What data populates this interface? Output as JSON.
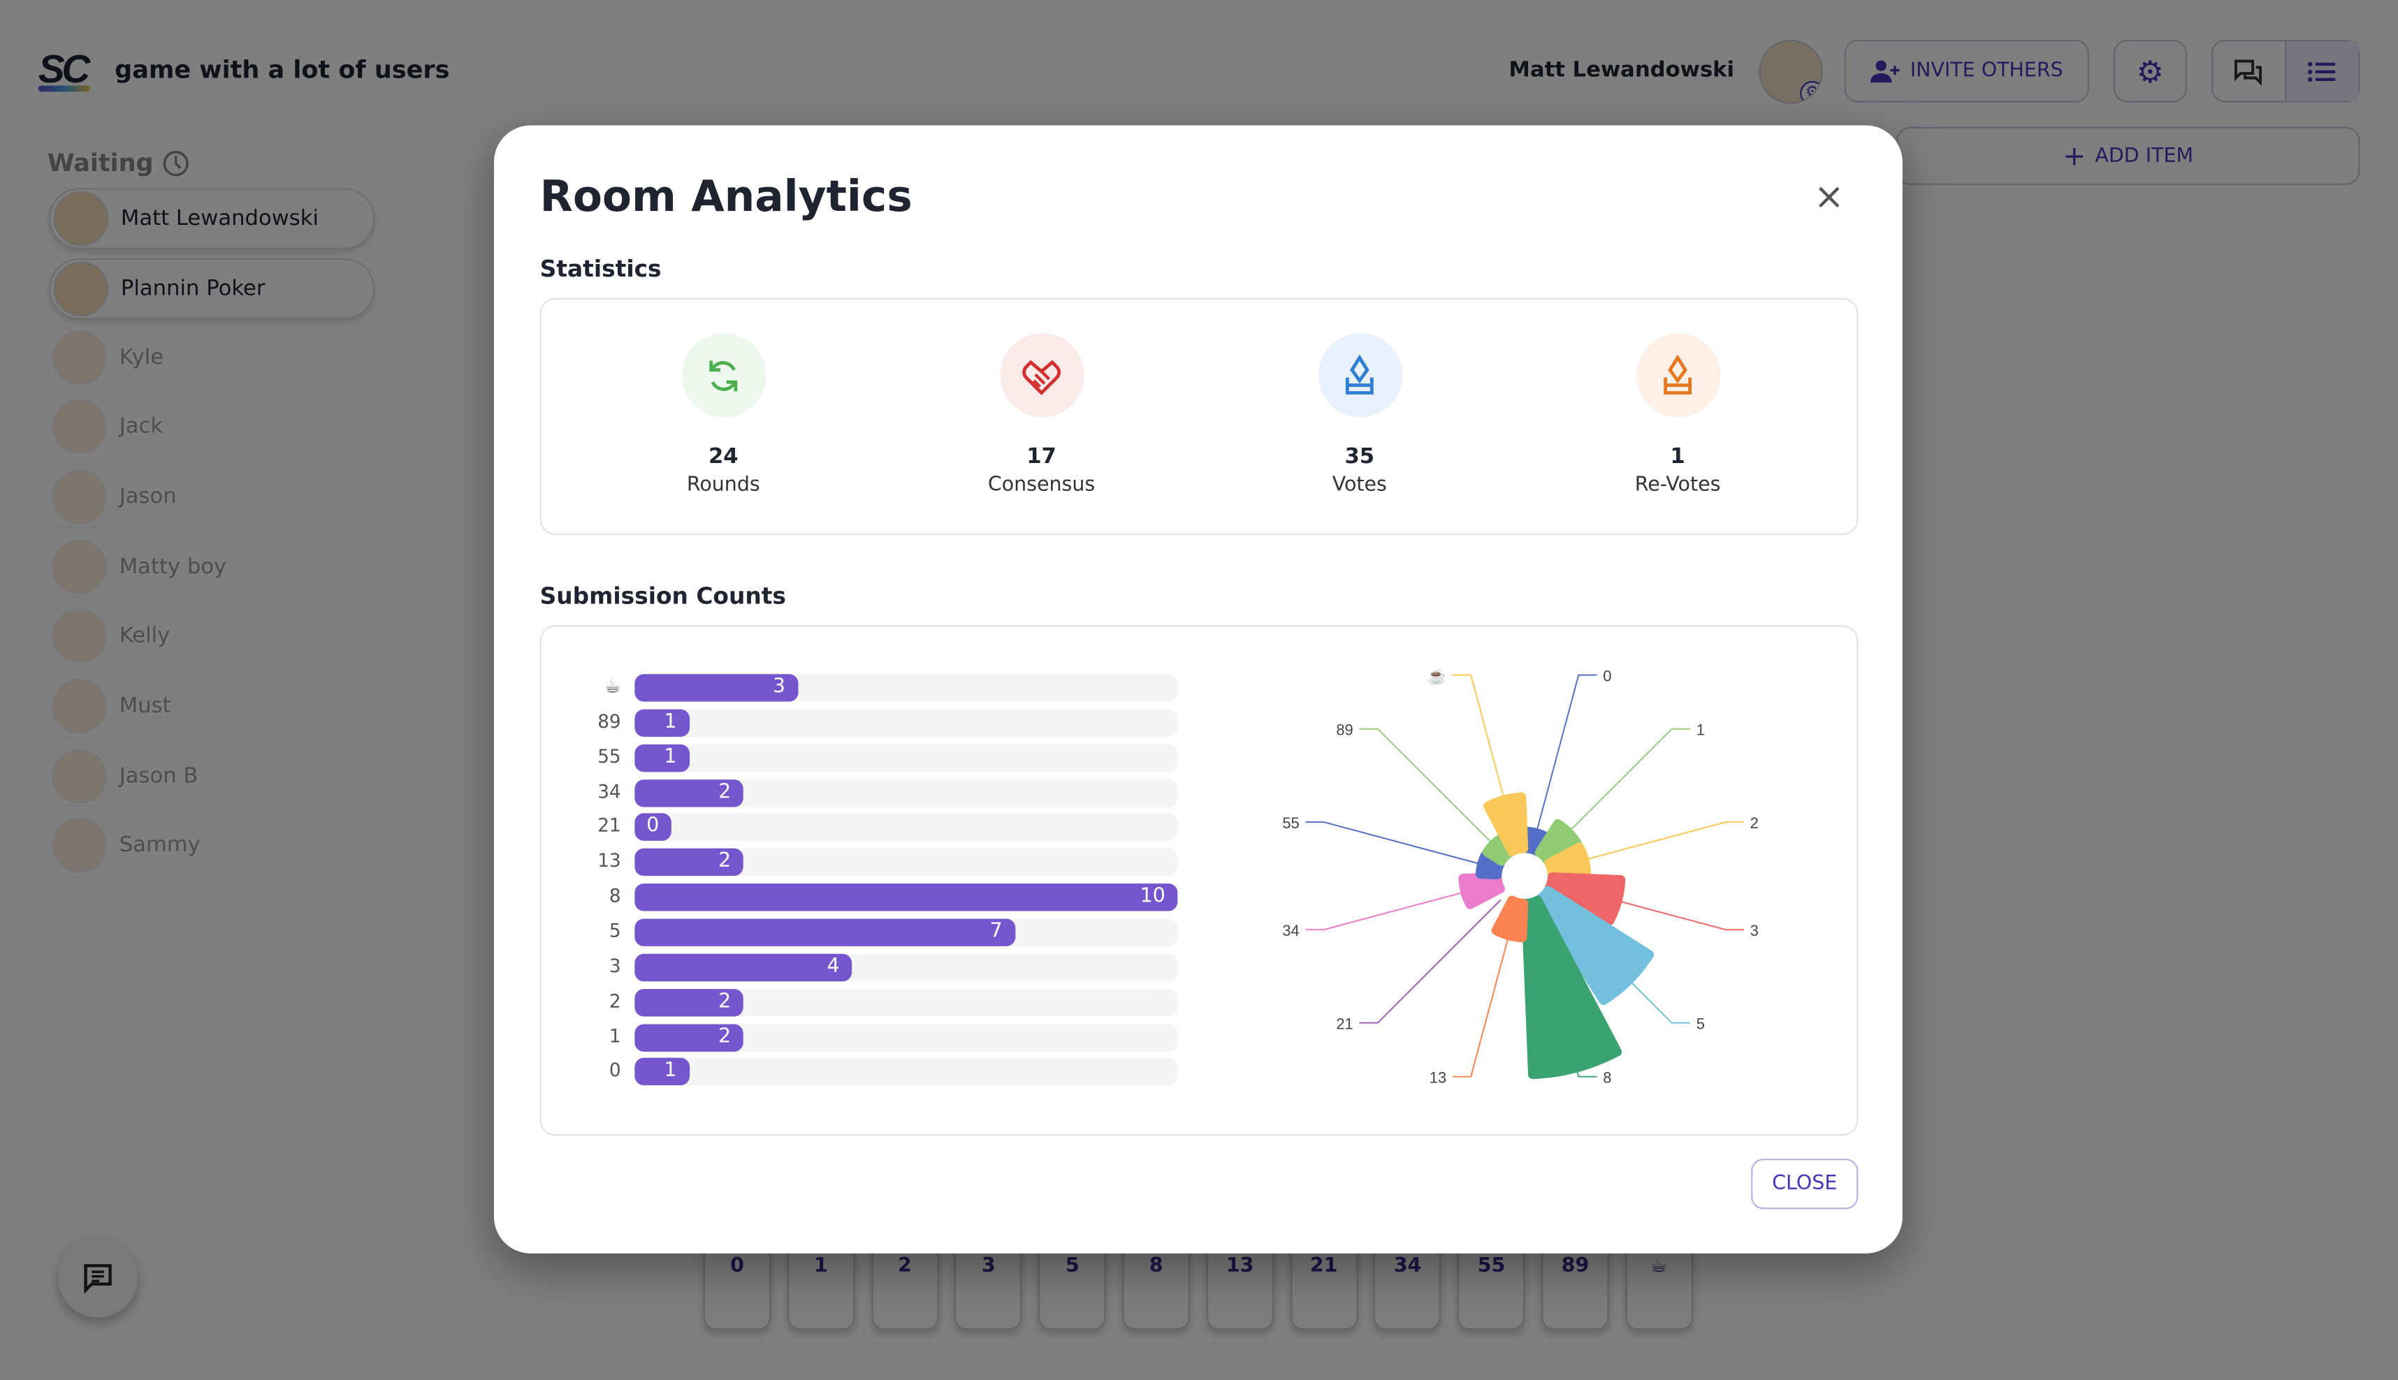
{
  "header": {
    "app_title": "game with a lot of users",
    "logo_text": "SC",
    "user_name": "Matt Lewandowski",
    "invite_label": "INVITE OTHERS",
    "add_item_label": "ADD ITEM"
  },
  "sidebar": {
    "waiting_label": "Waiting",
    "players": [
      {
        "name": "Matt Lewandowski",
        "active": true
      },
      {
        "name": "Plannin Poker",
        "active": true
      },
      {
        "name": "Kyle"
      },
      {
        "name": "Jack"
      },
      {
        "name": "Jason"
      },
      {
        "name": "Matty boy"
      },
      {
        "name": "Kelly"
      },
      {
        "name": "Must"
      },
      {
        "name": "Jason B"
      },
      {
        "name": "Sammy"
      }
    ]
  },
  "cards": [
    "0",
    "1",
    "2",
    "3",
    "5",
    "8",
    "13",
    "21",
    "34",
    "55",
    "89",
    "☕"
  ],
  "modal": {
    "title": "Room Analytics",
    "statistics_title": "Statistics",
    "stats": [
      {
        "value": "24",
        "label": "Rounds",
        "icon": "refresh-icon",
        "color": "#4caf50",
        "bg": "#edf7ee"
      },
      {
        "value": "17",
        "label": "Consensus",
        "icon": "handshake-icon",
        "color": "#d32f2f",
        "bg": "#fbeaea"
      },
      {
        "value": "35",
        "label": "Votes",
        "icon": "ballot-icon",
        "color": "#2f7fd6",
        "bg": "#e8f1fb"
      },
      {
        "value": "1",
        "label": "Re-Votes",
        "icon": "ballot-icon",
        "color": "#e87722",
        "bg": "#fdf0e7"
      }
    ],
    "submission_title": "Submission Counts",
    "close_label": "CLOSE"
  },
  "chart_data": [
    {
      "type": "bar",
      "orientation": "horizontal",
      "categories": [
        "☕",
        "89",
        "55",
        "34",
        "21",
        "13",
        "8",
        "5",
        "3",
        "2",
        "1",
        "0"
      ],
      "values": [
        3,
        1,
        1,
        2,
        0,
        2,
        10,
        7,
        4,
        2,
        2,
        1
      ],
      "xlim": [
        0,
        10
      ],
      "color": "#7556cf"
    },
    {
      "type": "pie",
      "rose": true,
      "categories": [
        "0",
        "1",
        "2",
        "3",
        "5",
        "8",
        "13",
        "21",
        "34",
        "55",
        "89",
        "☕"
      ],
      "values": [
        1,
        2,
        2,
        4,
        7,
        10,
        2,
        0,
        2,
        1,
        1,
        3
      ],
      "colors": [
        "#5470c6",
        "#91cc75",
        "#fac858",
        "#ee6666",
        "#73c0de",
        "#3ba272",
        "#fc8452",
        "#9a60b4",
        "#ea7ccc",
        "#5470c6",
        "#91cc75",
        "#fac858"
      ]
    }
  ]
}
